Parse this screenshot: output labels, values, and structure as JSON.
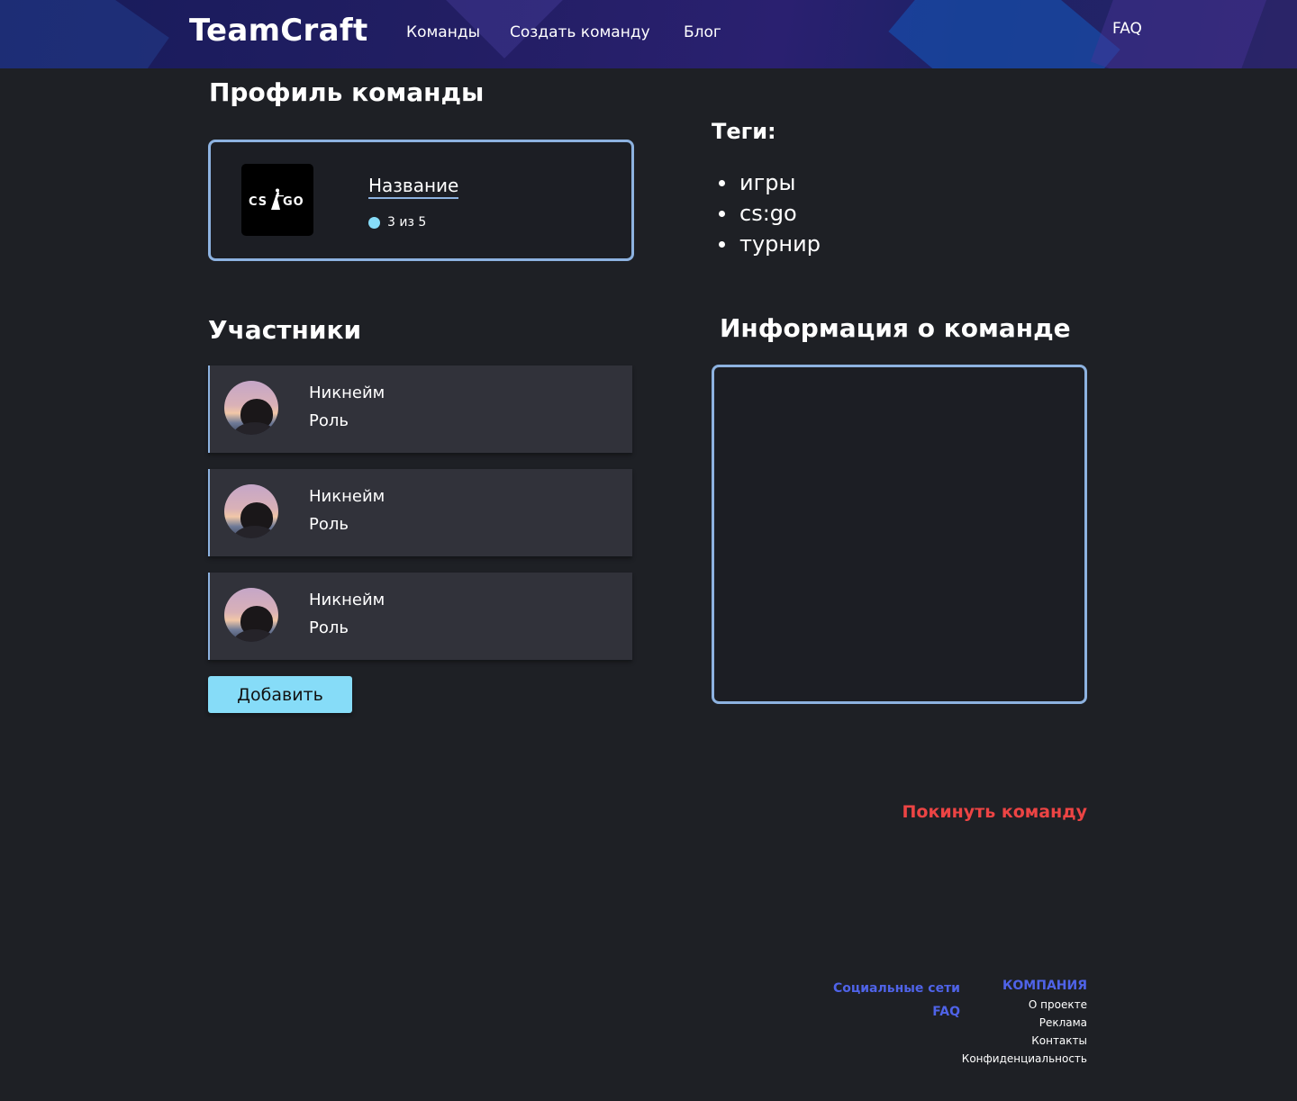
{
  "header": {
    "logo": "TeamCraft",
    "nav": {
      "teams": "Команды",
      "create_team": "Создать команду",
      "blog": "Блог",
      "faq": "FAQ"
    }
  },
  "profile": {
    "heading": "Профиль команды",
    "team": {
      "name": "Название",
      "members_count": "3 из 5",
      "logo_icon": "csgo-logo-icon"
    }
  },
  "tags": {
    "heading": "Теги:",
    "items": [
      "игры",
      "cs:go",
      "турнир"
    ]
  },
  "members": {
    "heading": "Участники",
    "items": [
      {
        "nickname": "Никнейм",
        "role": "Роль"
      },
      {
        "nickname": "Никнейм",
        "role": "Роль"
      },
      {
        "nickname": "Никнейм",
        "role": "Роль"
      }
    ],
    "add_button": "Добавить"
  },
  "info": {
    "heading": "Информация о команде"
  },
  "leave": {
    "label": "Покинуть команду"
  },
  "footer": {
    "social": "Социальные сети",
    "faq": "FAQ",
    "company_heading": "КОМПАНИЯ",
    "company_links": [
      "О проекте",
      "Реклама",
      "Контакты",
      "Конфиденциальность"
    ]
  },
  "colors": {
    "accent": "#86dcf8",
    "border": "#8db2e0",
    "danger": "#ec4444",
    "footer_link": "#4f63e8",
    "background": "#1e2025"
  }
}
